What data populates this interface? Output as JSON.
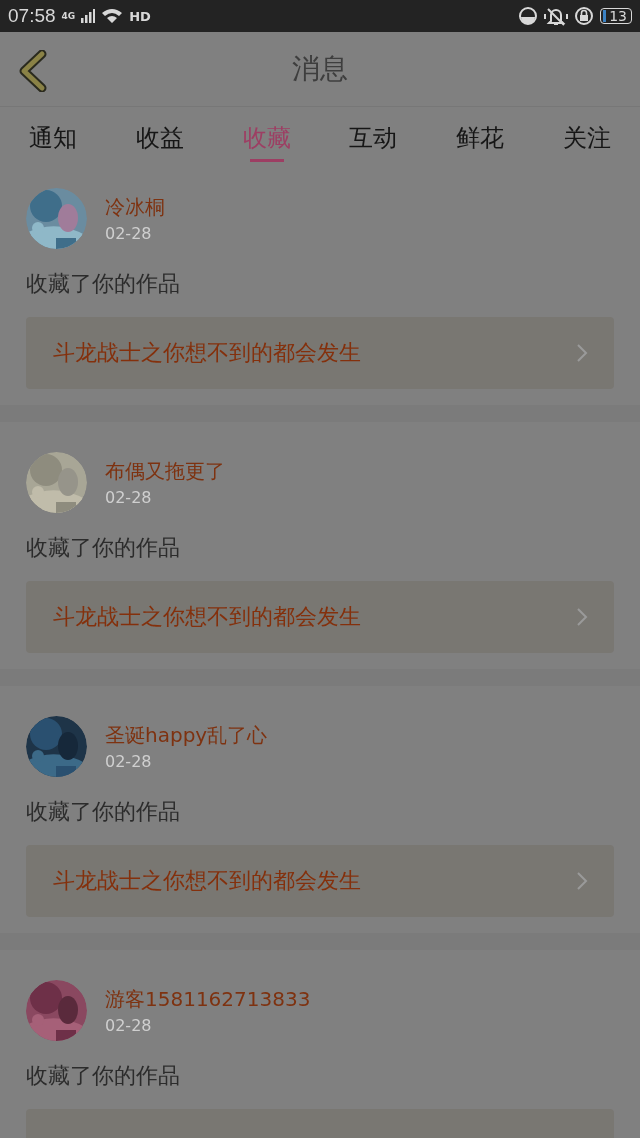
{
  "status_bar": {
    "time": "07:58",
    "network": "4G",
    "hd": "HD",
    "battery": "13"
  },
  "header": {
    "title": "消息"
  },
  "tabs": [
    {
      "label": "通知",
      "selected": false
    },
    {
      "label": "收益",
      "selected": false
    },
    {
      "label": "收藏",
      "selected": true
    },
    {
      "label": "互动",
      "selected": false
    },
    {
      "label": "鲜花",
      "selected": false
    },
    {
      "label": "关注",
      "selected": false
    }
  ],
  "messages": [
    {
      "user": "冷冰桐",
      "date": "02-28",
      "action": "收藏了你的作品",
      "work": "斗龙战士之你想不到的都会发生"
    },
    {
      "user": "布偶又拖更了",
      "date": "02-28",
      "action": "收藏了你的作品",
      "work": "斗龙战士之你想不到的都会发生"
    },
    {
      "user": "圣诞happy乱了心",
      "date": "02-28",
      "action": "收藏了你的作品",
      "work": "斗龙战士之你想不到的都会发生"
    },
    {
      "user": "游客1581162713833",
      "date": "02-28",
      "action": "收藏了你的作品"
    }
  ]
}
